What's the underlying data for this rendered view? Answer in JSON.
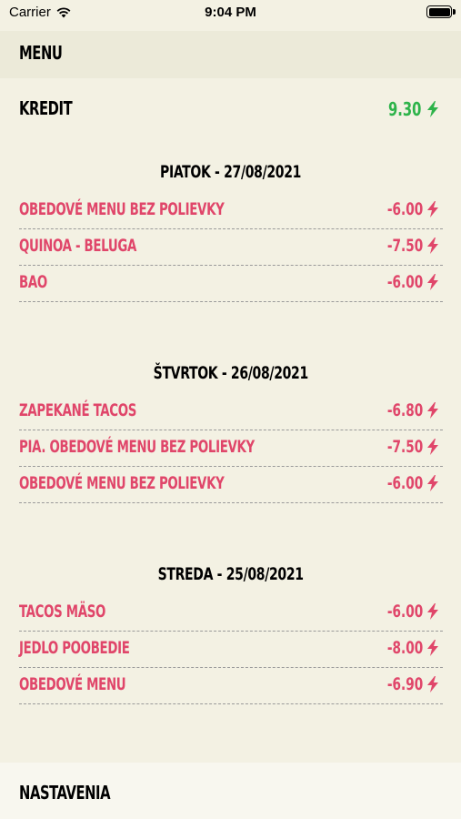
{
  "status_bar": {
    "carrier": "Carrier",
    "time": "9:04 PM"
  },
  "header": {
    "title": "MENU"
  },
  "credit": {
    "label": "KREDIT",
    "value": "9.30",
    "color": "#2db34a",
    "icon": "lightning-bolt-icon"
  },
  "days": [
    {
      "title": "PIATOK - 27/08/2021",
      "items": [
        {
          "name": "OBEDOVÉ MENU BEZ POLIEVKY",
          "price": "-6.00"
        },
        {
          "name": "QUINOA - BELUGA",
          "price": "-7.50"
        },
        {
          "name": "BAO",
          "price": "-6.00"
        }
      ]
    },
    {
      "title": "ŠTVRTOK - 26/08/2021",
      "items": [
        {
          "name": "ZAPEKANÉ TACOS",
          "price": "-6.80"
        },
        {
          "name": "PIA. OBEDOVÉ MENU BEZ POLIEVKY",
          "price": "-7.50"
        },
        {
          "name": "OBEDOVÉ MENU BEZ POLIEVKY",
          "price": "-6.00"
        }
      ]
    },
    {
      "title": "STREDA - 25/08/2021",
      "items": [
        {
          "name": "TACOS MÄSO",
          "price": "-6.00"
        },
        {
          "name": "JEDLO POOBEDIE",
          "price": "-8.00"
        },
        {
          "name": "OBEDOVÉ MENU",
          "price": "-6.90"
        }
      ]
    }
  ],
  "footer": {
    "settings_label": "NASTAVENIA"
  },
  "colors": {
    "background": "#f3f1e3",
    "expense": "#e0466a",
    "credit": "#2db34a",
    "divider": "#9a9a9a"
  }
}
